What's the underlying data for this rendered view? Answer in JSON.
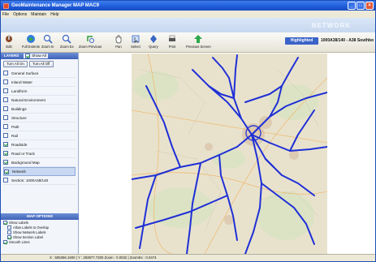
{
  "window": {
    "title": "GeoMaintenance Manager   MAP   MAC9"
  },
  "menu": {
    "items": [
      "File",
      "Options",
      "Maintain",
      "Help"
    ]
  },
  "network_band": {
    "label": "NETWORK"
  },
  "toolbar": {
    "tools": [
      {
        "label": "Edit",
        "icon": "edit-icon"
      },
      {
        "label": "Full Extents",
        "icon": "globe-icon"
      },
      {
        "label": "Zoom In",
        "icon": "zoom-in-icon"
      },
      {
        "label": "Zoom Ex",
        "icon": "zoom-out-icon"
      },
      {
        "label": "Zoom Previous",
        "icon": "zoom-previous-icon"
      },
      {
        "label": "Pan",
        "icon": "hand-icon"
      },
      {
        "label": "Select",
        "icon": "select-icon"
      },
      {
        "label": "Query",
        "icon": "query-icon"
      },
      {
        "label": "Print",
        "icon": "printer-icon"
      },
      {
        "label": "Previous Screen",
        "icon": "previous-screen-icon"
      }
    ],
    "highlighted_label": "Highlighted",
    "section_text": "1000A38/140 - A38 Southbo"
  },
  "layers": {
    "header": "LAYERS",
    "show_all_label": "Show All",
    "turn_all_on": "Turn All On",
    "turn_all_off": "Turn All Off",
    "items": [
      {
        "label": "General Surface",
        "checked": false
      },
      {
        "label": "Inland Water",
        "checked": false
      },
      {
        "label": "Landform",
        "checked": false
      },
      {
        "label": "Natural Environment",
        "checked": false
      },
      {
        "label": "Buildings",
        "checked": false
      },
      {
        "label": "Structure",
        "checked": false
      },
      {
        "label": "Path",
        "checked": false
      },
      {
        "label": "Rail",
        "checked": false
      },
      {
        "label": "Roadside",
        "checked": true
      },
      {
        "label": "Road or Track",
        "checked": true
      },
      {
        "label": "Background Map",
        "checked": true
      },
      {
        "label": "Network",
        "checked": true
      },
      {
        "label": "Section: 1000A38/140",
        "checked": false
      }
    ]
  },
  "map_options": {
    "header": "MAP OPTIONS",
    "items": [
      {
        "label": "Show Labels",
        "checked": true,
        "indent": false
      },
      {
        "label": "Allow Labels to Overlap",
        "checked": false,
        "indent": true
      },
      {
        "label": "Show Network Labels",
        "checked": false,
        "indent": true
      },
      {
        "label": "Show Section Label",
        "checked": true,
        "indent": true
      },
      {
        "label": "Smooth Lines",
        "checked": true,
        "indent": false
      }
    ]
  },
  "status": {
    "text": "X : 505356.1600 | Y : 293977.7200     Zoom : 0.0032 | ZoomEx : 0.0474"
  },
  "colors": {
    "network_line": "#1f2fd6",
    "titlebar": "#1f5bd8",
    "highlighted_tab": "#3a63c9"
  }
}
